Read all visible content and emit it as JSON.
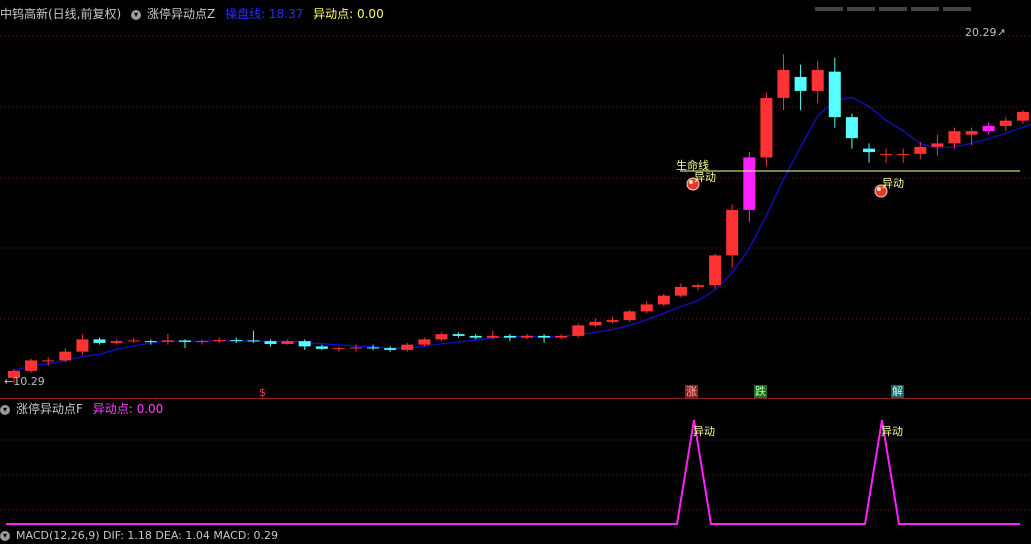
{
  "main_panel": {
    "title": "中钨高新(日线,前复权)",
    "indicator": "涨停异动点Z",
    "line_label": "操盘线: 18.37",
    "signal_label": "异动点: 0.00",
    "price_high": "20.29",
    "price_low": "10.29",
    "life_line_label": "生命线",
    "signal_text_1": "异动",
    "signal_text_2": "异动",
    "markers": [
      "$",
      "涨",
      "跌",
      "解"
    ]
  },
  "sub_panel": {
    "indicator": "涨停异动点F",
    "signal_label": "异动点: 0.00",
    "peak_label_1": "异动",
    "peak_label_2": "异动"
  },
  "bottom_panel": {
    "label": "MACD(12,26,9)  DIF: 1.18  DEA: 1.04  MACD: 0.29"
  },
  "colors": {
    "up": "#ff3333",
    "down": "#54ffff",
    "ma": "#1010c8",
    "life": "#ffff99",
    "magenta": "#ff20ff"
  },
  "chart_data": {
    "type": "candlestick",
    "y_range": [
      10.29,
      20.29
    ],
    "candles": [
      [
        10.35,
        10.6,
        10.2,
        10.55
      ],
      [
        10.55,
        10.9,
        10.5,
        10.85
      ],
      [
        10.85,
        10.95,
        10.7,
        10.85
      ],
      [
        10.85,
        11.2,
        10.8,
        11.1
      ],
      [
        11.1,
        11.6,
        11.0,
        11.45
      ],
      [
        11.45,
        11.5,
        11.3,
        11.35
      ],
      [
        11.35,
        11.45,
        11.3,
        11.4
      ],
      [
        11.4,
        11.5,
        11.35,
        11.42
      ],
      [
        11.4,
        11.45,
        11.3,
        11.38
      ],
      [
        11.38,
        11.6,
        11.3,
        11.42
      ],
      [
        11.42,
        11.45,
        11.2,
        11.38
      ],
      [
        11.38,
        11.45,
        11.3,
        11.4
      ],
      [
        11.4,
        11.5,
        11.35,
        11.43
      ],
      [
        11.43,
        11.5,
        11.35,
        11.42
      ],
      [
        11.42,
        11.7,
        11.35,
        11.4
      ],
      [
        11.4,
        11.45,
        11.25,
        11.32
      ],
      [
        11.32,
        11.45,
        11.3,
        11.4
      ],
      [
        11.4,
        11.45,
        11.15,
        11.25
      ],
      [
        11.25,
        11.3,
        11.15,
        11.18
      ],
      [
        11.18,
        11.25,
        11.1,
        11.2
      ],
      [
        11.2,
        11.3,
        11.1,
        11.22
      ],
      [
        11.22,
        11.3,
        11.15,
        11.2
      ],
      [
        11.2,
        11.25,
        11.1,
        11.15
      ],
      [
        11.15,
        11.35,
        11.1,
        11.3
      ],
      [
        11.3,
        11.5,
        11.25,
        11.45
      ],
      [
        11.45,
        11.65,
        11.4,
        11.6
      ],
      [
        11.6,
        11.65,
        11.5,
        11.55
      ],
      [
        11.55,
        11.6,
        11.45,
        11.5
      ],
      [
        11.5,
        11.7,
        11.45,
        11.55
      ],
      [
        11.55,
        11.6,
        11.4,
        11.5
      ],
      [
        11.5,
        11.6,
        11.45,
        11.55
      ],
      [
        11.55,
        11.6,
        11.35,
        11.5
      ],
      [
        11.5,
        11.6,
        11.45,
        11.55
      ],
      [
        11.55,
        11.9,
        11.5,
        11.85
      ],
      [
        11.85,
        12.05,
        11.8,
        11.95
      ],
      [
        11.95,
        12.1,
        11.9,
        12.0
      ],
      [
        12.0,
        12.3,
        11.95,
        12.25
      ],
      [
        12.25,
        12.55,
        12.2,
        12.45
      ],
      [
        12.45,
        12.75,
        12.4,
        12.7
      ],
      [
        12.7,
        13.05,
        12.65,
        12.95
      ],
      [
        12.95,
        13.05,
        12.85,
        13.0
      ],
      [
        13.0,
        13.9,
        12.9,
        13.85
      ],
      [
        13.85,
        15.3,
        13.5,
        15.15
      ],
      [
        15.15,
        16.8,
        14.8,
        16.65
      ],
      [
        16.65,
        18.5,
        16.4,
        18.35
      ],
      [
        18.35,
        19.6,
        18.0,
        19.15
      ],
      [
        18.95,
        19.3,
        18.0,
        18.55
      ],
      [
        18.55,
        19.4,
        18.2,
        19.15
      ],
      [
        19.1,
        19.5,
        17.5,
        17.8
      ],
      [
        17.8,
        17.9,
        16.9,
        17.2
      ],
      [
        16.9,
        17.05,
        16.5,
        16.8
      ],
      [
        16.75,
        16.9,
        16.5,
        16.75
      ],
      [
        16.75,
        16.9,
        16.5,
        16.75
      ],
      [
        16.75,
        17.1,
        16.6,
        16.95
      ],
      [
        16.95,
        17.3,
        16.7,
        17.05
      ],
      [
        17.05,
        17.5,
        16.9,
        17.4
      ],
      [
        17.3,
        17.5,
        17.0,
        17.4
      ],
      [
        17.4,
        17.65,
        17.3,
        17.55
      ],
      [
        17.55,
        17.8,
        17.4,
        17.7
      ],
      [
        17.7,
        18.0,
        17.6,
        17.95
      ],
      [
        17.95,
        18.1,
        17.85,
        18.05
      ],
      [
        18.05,
        18.7,
        17.95,
        18.6
      ],
      [
        18.6,
        19.35,
        18.5,
        19.25
      ],
      [
        19.25,
        20.29,
        19.0,
        19.95
      ]
    ],
    "limit_up_days": [
      43,
      57
    ]
  }
}
